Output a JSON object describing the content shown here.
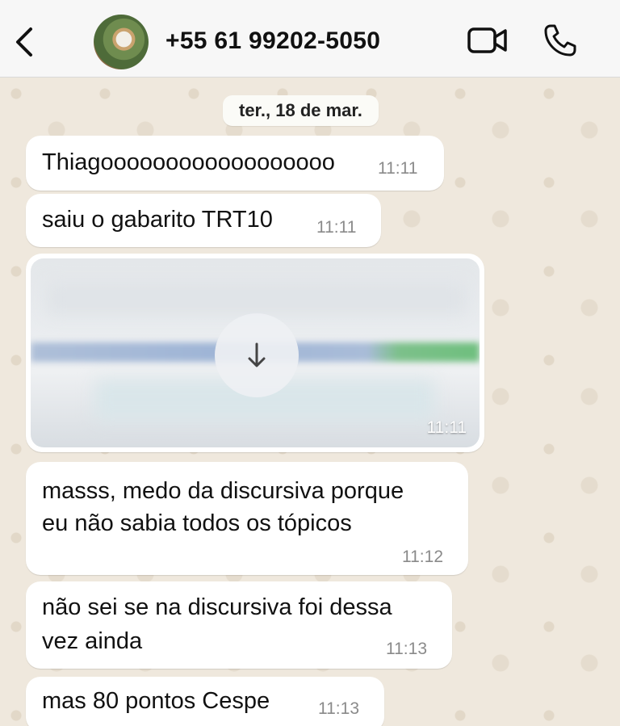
{
  "header": {
    "contact_name": "+55 61 99202-5050",
    "back_icon": "chevron-left-icon",
    "video_icon": "video-camera-icon",
    "call_icon": "phone-icon"
  },
  "chat": {
    "date_label": "ter., 18 de mar.",
    "messages": [
      {
        "text": "Thiagoooooooooooooooooo",
        "time": "11:11"
      },
      {
        "text": "saiu o gabarito TRT10",
        "time": "11:11"
      },
      {
        "text": "",
        "time": "11:11"
      },
      {
        "line1": "masss, medo da discursiva porque",
        "line2": "eu não sabia todos os tópicos",
        "time": "11:12"
      },
      {
        "line1": "não sei se na discursiva foi dessa",
        "line2": "vez ainda",
        "time": "11:13"
      },
      {
        "text": "mas 80 pontos Cespe",
        "time": "11:13"
      }
    ]
  }
}
